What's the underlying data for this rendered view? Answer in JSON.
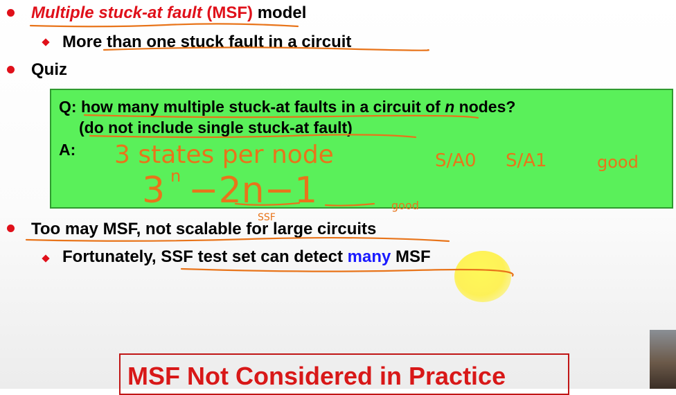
{
  "slide": {
    "line1": {
      "italic_term": "Multiple stuck-at fault",
      "abbrev": "(MSF)",
      "tail": "model"
    },
    "line1_sub": "More than one stuck fault in a circuit",
    "line2": "Quiz",
    "quiz": {
      "q_prefix": "Q: how many multiple stuck-at faults in a circuit of ",
      "q_var": "n",
      "q_suffix": " nodes?",
      "q_line2": "(do not include single stuck-at fault)",
      "a_label": "A:"
    },
    "line3": {
      "part1": "Too may MSF",
      "part2": ", not scalable for large circuits"
    },
    "line3_sub": {
      "part1": "Fortunately, SSF test set can detect ",
      "highlight": "many",
      "part2": " MSF"
    },
    "bottom_box": "MSF Not Considered in Practice"
  },
  "handwriting": {
    "line1": "3 states per node",
    "sa0": "S/A0",
    "sa1": "S/A1",
    "good1": "good",
    "formula_base": "3",
    "formula_exp": "n",
    "formula_mid": "−2n−1",
    "ssf": "SSF",
    "good2": "good"
  },
  "colors": {
    "accent_red": "#e0101a",
    "quiz_green": "#5af05a",
    "ink_orange": "#e8741a",
    "highlight_blue": "#1a1aff"
  }
}
